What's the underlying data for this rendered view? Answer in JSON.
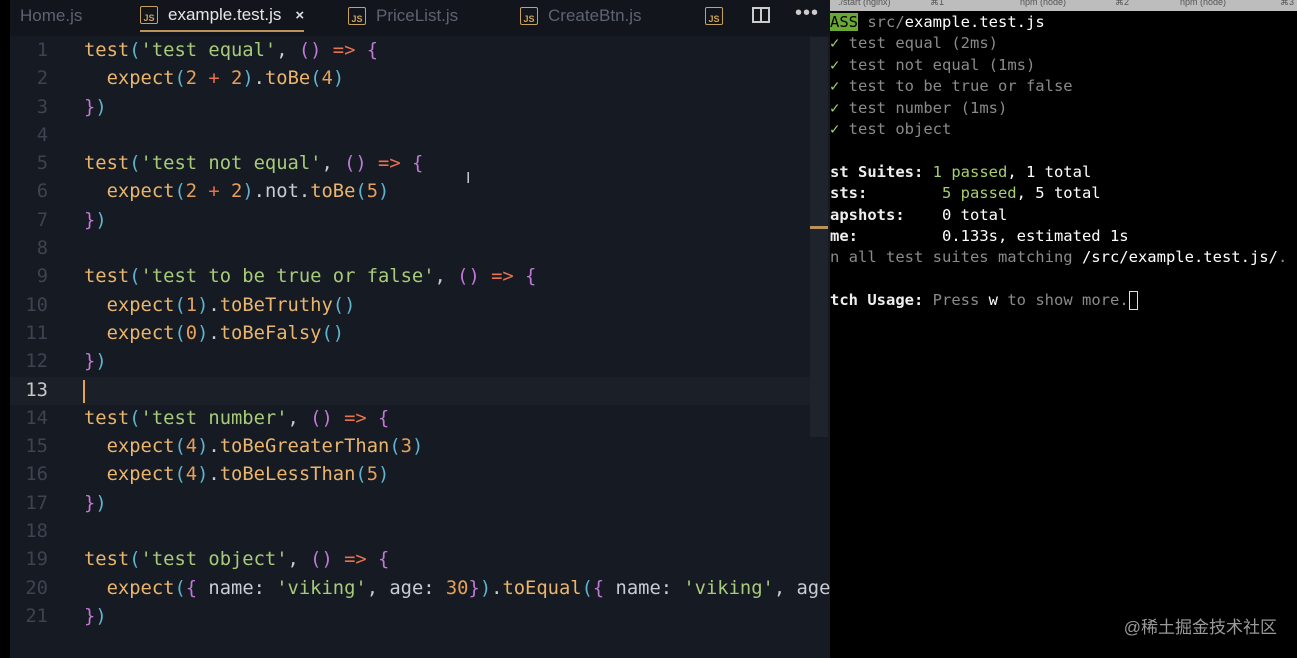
{
  "editor": {
    "tabs": [
      {
        "label": "Home.js"
      },
      {
        "label": "example.test.js",
        "active": true
      },
      {
        "label": "PriceList.js"
      },
      {
        "label": "CreateBtn.js"
      },
      {
        "label": ""
      }
    ],
    "js_badge": "JS",
    "close_glyph": "×",
    "more_glyph": "•••",
    "text_cursor": "I",
    "current_line": 13,
    "lines": [
      [
        [
          "fn",
          "test"
        ],
        [
          "pa",
          "("
        ],
        [
          "str",
          "'test equal'"
        ],
        [
          "pl",
          ", "
        ],
        [
          "br",
          "()"
        ],
        [
          "op",
          " => "
        ],
        [
          "br",
          "{"
        ]
      ],
      [
        [
          "pl",
          "  "
        ],
        [
          "fn",
          "expect"
        ],
        [
          "pa",
          "("
        ],
        [
          "num",
          "2"
        ],
        [
          "op",
          " + "
        ],
        [
          "num",
          "2"
        ],
        [
          "pa",
          ")"
        ],
        [
          "dot",
          "."
        ],
        [
          "fn",
          "toBe"
        ],
        [
          "pa",
          "("
        ],
        [
          "num",
          "4"
        ],
        [
          "pa",
          ")"
        ]
      ],
      [
        [
          "br",
          "}"
        ],
        [
          "pa",
          ")"
        ]
      ],
      [],
      [
        [
          "fn",
          "test"
        ],
        [
          "pa",
          "("
        ],
        [
          "str",
          "'test not equal'"
        ],
        [
          "pl",
          ", "
        ],
        [
          "br",
          "()"
        ],
        [
          "op",
          " => "
        ],
        [
          "br",
          "{"
        ]
      ],
      [
        [
          "pl",
          "  "
        ],
        [
          "fn",
          "expect"
        ],
        [
          "pa",
          "("
        ],
        [
          "num",
          "2"
        ],
        [
          "op",
          " + "
        ],
        [
          "num",
          "2"
        ],
        [
          "pa",
          ")"
        ],
        [
          "dot",
          "."
        ],
        [
          "pl",
          "not"
        ],
        [
          "dot",
          "."
        ],
        [
          "fn",
          "toBe"
        ],
        [
          "pa",
          "("
        ],
        [
          "num",
          "5"
        ],
        [
          "pa",
          ")"
        ]
      ],
      [
        [
          "br",
          "}"
        ],
        [
          "pa",
          ")"
        ]
      ],
      [],
      [
        [
          "fn",
          "test"
        ],
        [
          "pa",
          "("
        ],
        [
          "str",
          "'test to be true or false'"
        ],
        [
          "pl",
          ", "
        ],
        [
          "br",
          "()"
        ],
        [
          "op",
          " => "
        ],
        [
          "br",
          "{"
        ]
      ],
      [
        [
          "pl",
          "  "
        ],
        [
          "fn",
          "expect"
        ],
        [
          "pa",
          "("
        ],
        [
          "num",
          "1"
        ],
        [
          "pa",
          ")"
        ],
        [
          "dot",
          "."
        ],
        [
          "fn",
          "toBeTruthy"
        ],
        [
          "pa",
          "()"
        ]
      ],
      [
        [
          "pl",
          "  "
        ],
        [
          "fn",
          "expect"
        ],
        [
          "pa",
          "("
        ],
        [
          "num",
          "0"
        ],
        [
          "pa",
          ")"
        ],
        [
          "dot",
          "."
        ],
        [
          "fn",
          "toBeFalsy"
        ],
        [
          "pa",
          "()"
        ]
      ],
      [
        [
          "br",
          "}"
        ],
        [
          "pa",
          ")"
        ]
      ],
      [],
      [
        [
          "fn",
          "test"
        ],
        [
          "pa",
          "("
        ],
        [
          "str",
          "'test number'"
        ],
        [
          "pl",
          ", "
        ],
        [
          "br",
          "()"
        ],
        [
          "op",
          " => "
        ],
        [
          "br",
          "{"
        ]
      ],
      [
        [
          "pl",
          "  "
        ],
        [
          "fn",
          "expect"
        ],
        [
          "pa",
          "("
        ],
        [
          "num",
          "4"
        ],
        [
          "pa",
          ")"
        ],
        [
          "dot",
          "."
        ],
        [
          "fn",
          "toBeGreaterThan"
        ],
        [
          "pa",
          "("
        ],
        [
          "num",
          "3"
        ],
        [
          "pa",
          ")"
        ]
      ],
      [
        [
          "pl",
          "  "
        ],
        [
          "fn",
          "expect"
        ],
        [
          "pa",
          "("
        ],
        [
          "num",
          "4"
        ],
        [
          "pa",
          ")"
        ],
        [
          "dot",
          "."
        ],
        [
          "fn",
          "toBeLessThan"
        ],
        [
          "pa",
          "("
        ],
        [
          "num",
          "5"
        ],
        [
          "pa",
          ")"
        ]
      ],
      [
        [
          "br",
          "}"
        ],
        [
          "pa",
          ")"
        ]
      ],
      [],
      [
        [
          "fn",
          "test"
        ],
        [
          "pa",
          "("
        ],
        [
          "str",
          "'test object'"
        ],
        [
          "pl",
          ", "
        ],
        [
          "br",
          "()"
        ],
        [
          "op",
          " => "
        ],
        [
          "br",
          "{"
        ]
      ],
      [
        [
          "pl",
          "  "
        ],
        [
          "fn",
          "expect"
        ],
        [
          "pa",
          "("
        ],
        [
          "br",
          "{ "
        ],
        [
          "pl",
          "name: "
        ],
        [
          "str",
          "'viking'"
        ],
        [
          "pl",
          ", age: "
        ],
        [
          "num",
          "30"
        ],
        [
          "br",
          "}"
        ],
        [
          "pa",
          ")"
        ],
        [
          "dot",
          "."
        ],
        [
          "fn",
          "toEqual"
        ],
        [
          "pa",
          "("
        ],
        [
          "br",
          "{ "
        ],
        [
          "pl",
          "name: "
        ],
        [
          "str",
          "'viking'"
        ],
        [
          "pl",
          ", age"
        ]
      ],
      [
        [
          "br",
          "}"
        ],
        [
          "pa",
          ")"
        ]
      ]
    ]
  },
  "terminal": {
    "tabs": [
      {
        "label": "./start (nginx)",
        "shortcut": "⌘1"
      },
      {
        "label": "npm (node)",
        "shortcut": "⌘2"
      },
      {
        "label": "npm (node)",
        "shortcut": "⌘3"
      }
    ],
    "lines": [
      [
        [
          "pass",
          "ASS"
        ],
        [
          "dim",
          " src/"
        ],
        [
          "w",
          "example.test.js"
        ]
      ],
      [
        [
          "g",
          "✓"
        ],
        [
          "dim",
          " test equal (2ms)"
        ]
      ],
      [
        [
          "g",
          "✓"
        ],
        [
          "dim",
          " test not equal (1ms)"
        ]
      ],
      [
        [
          "g",
          "✓"
        ],
        [
          "dim",
          " test to be true or false"
        ]
      ],
      [
        [
          "g",
          "✓"
        ],
        [
          "dim",
          " test number (1ms)"
        ]
      ],
      [
        [
          "g",
          "✓"
        ],
        [
          "dim",
          " test object"
        ]
      ],
      [],
      [
        [
          "bold",
          "st Suites: "
        ],
        [
          "g",
          "1 passed"
        ],
        [
          "w",
          ", 1 total"
        ]
      ],
      [
        [
          "bold",
          "sts:        "
        ],
        [
          "g",
          "5 passed"
        ],
        [
          "w",
          ", 5 total"
        ]
      ],
      [
        [
          "bold",
          "apshots:   "
        ],
        [
          "w",
          " 0 total"
        ]
      ],
      [
        [
          "bold",
          "me:        "
        ],
        [
          "w",
          " 0.133s, estimated 1s"
        ]
      ],
      [
        [
          "dim",
          "n all test suites matching "
        ],
        [
          "w",
          "/src/example.test.js/"
        ],
        [
          "dim",
          "."
        ]
      ],
      [],
      [
        [
          "bold",
          "tch Usage: "
        ],
        [
          "dim",
          "Press "
        ],
        [
          "w",
          "w"
        ],
        [
          "dim",
          " to show more."
        ]
      ]
    ]
  },
  "watermark": "@稀土掘金技术社区"
}
